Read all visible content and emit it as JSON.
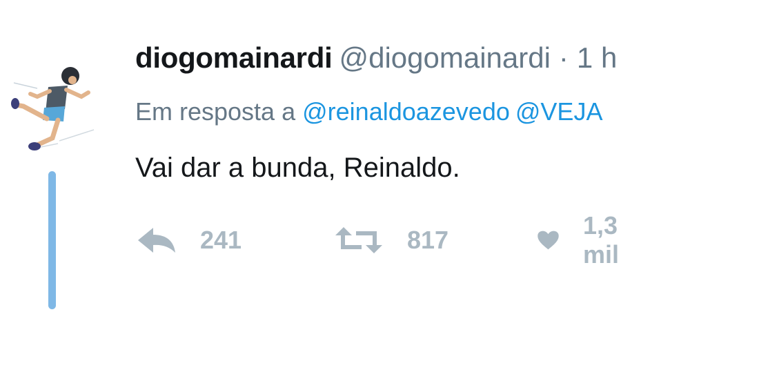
{
  "tweet": {
    "display_name": "diogomainardi",
    "handle": "@diogomainardi",
    "separator": "·",
    "time": "1 h",
    "reply_prefix": "Em resposta a",
    "mentions": [
      "@reinaldoazevedo",
      "@VEJA"
    ],
    "text": "Vai dar a bunda, Reinaldo."
  },
  "actions": {
    "replies": "241",
    "retweets": "817",
    "likes": "1,3 mil"
  },
  "icons": {
    "reply": "reply-icon",
    "retweet": "retweet-icon",
    "like": "heart-icon"
  },
  "colors": {
    "link": "#1b95e0",
    "muted": "#657786",
    "action": "#aab8c2",
    "thread_line": "#7fb8e6"
  }
}
